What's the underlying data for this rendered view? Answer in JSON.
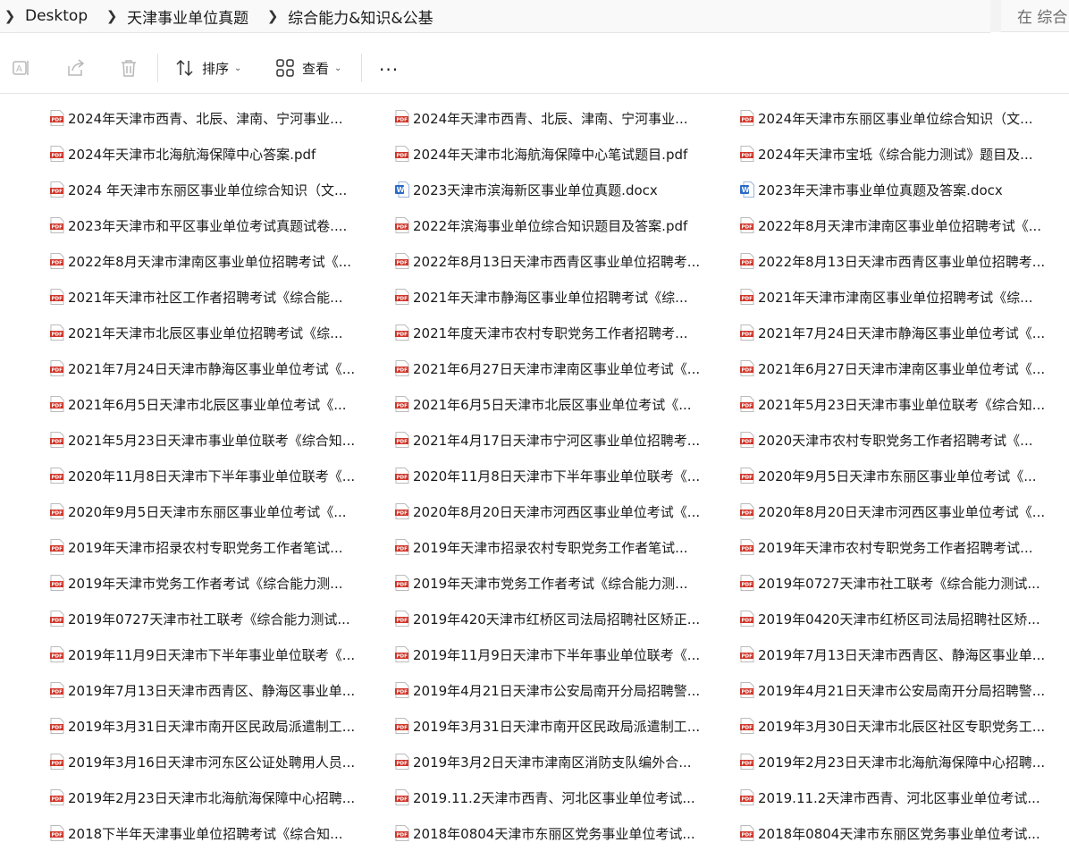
{
  "breadcrumb": [
    "Desktop",
    "天津事业单位真题",
    "综合能力&知识&公基"
  ],
  "search": {
    "placeholder": "在 综合"
  },
  "toolbar": {
    "sort_label": "排序",
    "view_label": "查看",
    "more_label": "···"
  },
  "files": [
    {
      "name": "2024年天津市西青、北辰、津南、宁河事业...",
      "type": "pdf"
    },
    {
      "name": "2024年天津市西青、北辰、津南、宁河事业...",
      "type": "pdf"
    },
    {
      "name": "2024年天津市东丽区事业单位综合知识（文...",
      "type": "pdf"
    },
    {
      "name": "2024年天津市北海航海保障中心答案.pdf",
      "type": "pdf"
    },
    {
      "name": "2024年天津市北海航海保障中心笔试题目.pdf",
      "type": "pdf"
    },
    {
      "name": "2024年天津市宝坻《综合能力测试》题目及...",
      "type": "pdf"
    },
    {
      "name": "2024 年天津市东丽区事业单位综合知识（文...",
      "type": "pdf"
    },
    {
      "name": "2023天津市滨海新区事业单位真题.docx",
      "type": "docx"
    },
    {
      "name": "2023年天津市事业单位真题及答案.docx",
      "type": "docx"
    },
    {
      "name": "2023年天津市和平区事业单位考试真题试卷....",
      "type": "pdf"
    },
    {
      "name": "2022年滨海事业单位综合知识题目及答案.pdf",
      "type": "pdf"
    },
    {
      "name": "2022年8月天津市津南区事业单位招聘考试《...",
      "type": "pdf"
    },
    {
      "name": "2022年8月天津市津南区事业单位招聘考试《...",
      "type": "pdf"
    },
    {
      "name": "2022年8月13日天津市西青区事业单位招聘考...",
      "type": "pdf"
    },
    {
      "name": "2022年8月13日天津市西青区事业单位招聘考...",
      "type": "pdf"
    },
    {
      "name": "2021年天津市社区工作者招聘考试《综合能...",
      "type": "pdf"
    },
    {
      "name": "2021年天津市静海区事业单位招聘考试《综...",
      "type": "pdf"
    },
    {
      "name": "2021年天津市津南区事业单位招聘考试《综...",
      "type": "pdf"
    },
    {
      "name": "2021年天津市北辰区事业单位招聘考试《综...",
      "type": "pdf"
    },
    {
      "name": "2021年度天津市农村专职党务工作者招聘考...",
      "type": "pdf"
    },
    {
      "name": "2021年7月24日天津市静海区事业单位考试《...",
      "type": "pdf"
    },
    {
      "name": "2021年7月24日天津市静海区事业单位考试《...",
      "type": "pdf"
    },
    {
      "name": "2021年6月27日天津市津南区事业单位考试《...",
      "type": "pdf"
    },
    {
      "name": "2021年6月27日天津市津南区事业单位考试《...",
      "type": "pdf"
    },
    {
      "name": "2021年6月5日天津市北辰区事业单位考试《...",
      "type": "pdf"
    },
    {
      "name": "2021年6月5日天津市北辰区事业单位考试《...",
      "type": "pdf"
    },
    {
      "name": "2021年5月23日天津市事业单位联考《综合知...",
      "type": "pdf"
    },
    {
      "name": "2021年5月23日天津市事业单位联考《综合知...",
      "type": "pdf"
    },
    {
      "name": "2021年4月17日天津市宁河区事业单位招聘考...",
      "type": "pdf"
    },
    {
      "name": "2020天津市农村专职党务工作者招聘考试《...",
      "type": "pdf"
    },
    {
      "name": "2020年11月8日天津市下半年事业单位联考《...",
      "type": "pdf"
    },
    {
      "name": "2020年11月8日天津市下半年事业单位联考《...",
      "type": "pdf"
    },
    {
      "name": "2020年9月5日天津市东丽区事业单位考试《...",
      "type": "pdf"
    },
    {
      "name": "2020年9月5日天津市东丽区事业单位考试《...",
      "type": "pdf"
    },
    {
      "name": "2020年8月20日天津市河西区事业单位考试《...",
      "type": "pdf"
    },
    {
      "name": "2020年8月20日天津市河西区事业单位考试《...",
      "type": "pdf"
    },
    {
      "name": "2019年天津市招录农村专职党务工作者笔试...",
      "type": "pdf"
    },
    {
      "name": "2019年天津市招录农村专职党务工作者笔试...",
      "type": "pdf"
    },
    {
      "name": "2019年天津市农村专职党务工作者招聘考试...",
      "type": "pdf"
    },
    {
      "name": "2019年天津市党务工作者考试《综合能力测...",
      "type": "pdf"
    },
    {
      "name": "2019年天津市党务工作者考试《综合能力测...",
      "type": "pdf"
    },
    {
      "name": "2019年0727天津市社工联考《综合能力测试...",
      "type": "pdf"
    },
    {
      "name": "2019年0727天津市社工联考《综合能力测试...",
      "type": "pdf"
    },
    {
      "name": "2019年420天津市红桥区司法局招聘社区矫正...",
      "type": "pdf"
    },
    {
      "name": "2019年0420天津市红桥区司法局招聘社区矫...",
      "type": "pdf"
    },
    {
      "name": "2019年11月9日天津市下半年事业单位联考《...",
      "type": "pdf"
    },
    {
      "name": "2019年11月9日天津市下半年事业单位联考《...",
      "type": "pdf"
    },
    {
      "name": "2019年7月13日天津市西青区、静海区事业单...",
      "type": "pdf"
    },
    {
      "name": "2019年7月13日天津市西青区、静海区事业单...",
      "type": "pdf"
    },
    {
      "name": "2019年4月21日天津市公安局南开分局招聘警...",
      "type": "pdf"
    },
    {
      "name": "2019年4月21日天津市公安局南开分局招聘警...",
      "type": "pdf"
    },
    {
      "name": "2019年3月31日天津市南开区民政局派遣制工...",
      "type": "pdf"
    },
    {
      "name": "2019年3月31日天津市南开区民政局派遣制工...",
      "type": "pdf"
    },
    {
      "name": "2019年3月30日天津市北辰区社区专职党务工...",
      "type": "pdf"
    },
    {
      "name": "2019年3月16日天津市河东区公证处聘用人员...",
      "type": "pdf"
    },
    {
      "name": "2019年3月2日天津市津南区消防支队编外合...",
      "type": "pdf"
    },
    {
      "name": "2019年2月23日天津市北海航海保障中心招聘...",
      "type": "pdf"
    },
    {
      "name": "2019年2月23日天津市北海航海保障中心招聘...",
      "type": "pdf"
    },
    {
      "name": "2019.11.2天津市西青、河北区事业单位考试...",
      "type": "pdf"
    },
    {
      "name": "2019.11.2天津市西青、河北区事业单位考试...",
      "type": "pdf"
    },
    {
      "name": "2018下半年天津事业单位招聘考试《综合知...",
      "type": "pdf"
    },
    {
      "name": "2018年0804天津市东丽区党务事业单位考试...",
      "type": "pdf"
    },
    {
      "name": "2018年0804天津市东丽区党务事业单位考试...",
      "type": "pdf"
    }
  ],
  "colors": {
    "pdf": "#d0362a",
    "docx": "#2b6bc7",
    "toolbar_disabled": "#b8b8b8"
  }
}
